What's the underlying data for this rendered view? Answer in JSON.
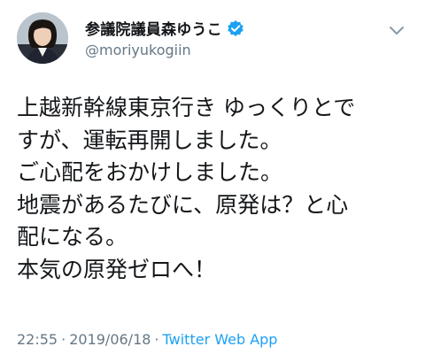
{
  "account": {
    "display_name": "参議院議員森ゆうこ",
    "handle": "@moriyukogiin",
    "verified_icon": "verified-badge-icon",
    "avatar_icon": "profile-photo"
  },
  "tweet": {
    "lines": [
      "上越新幹線東京行き ゆっくりとで",
      "すが、運転再開しました。",
      "ご心配をおかけしました。",
      "地震があるたびに、原発は？と心",
      "配になる。",
      "本気の原発ゼロへ！"
    ]
  },
  "meta": {
    "time": "22:55",
    "separator": "·",
    "date": "2019/06/18",
    "app": "Twitter Web App"
  },
  "colors": {
    "text": "#14171a",
    "muted": "#657786",
    "accent": "#1da1f2"
  }
}
